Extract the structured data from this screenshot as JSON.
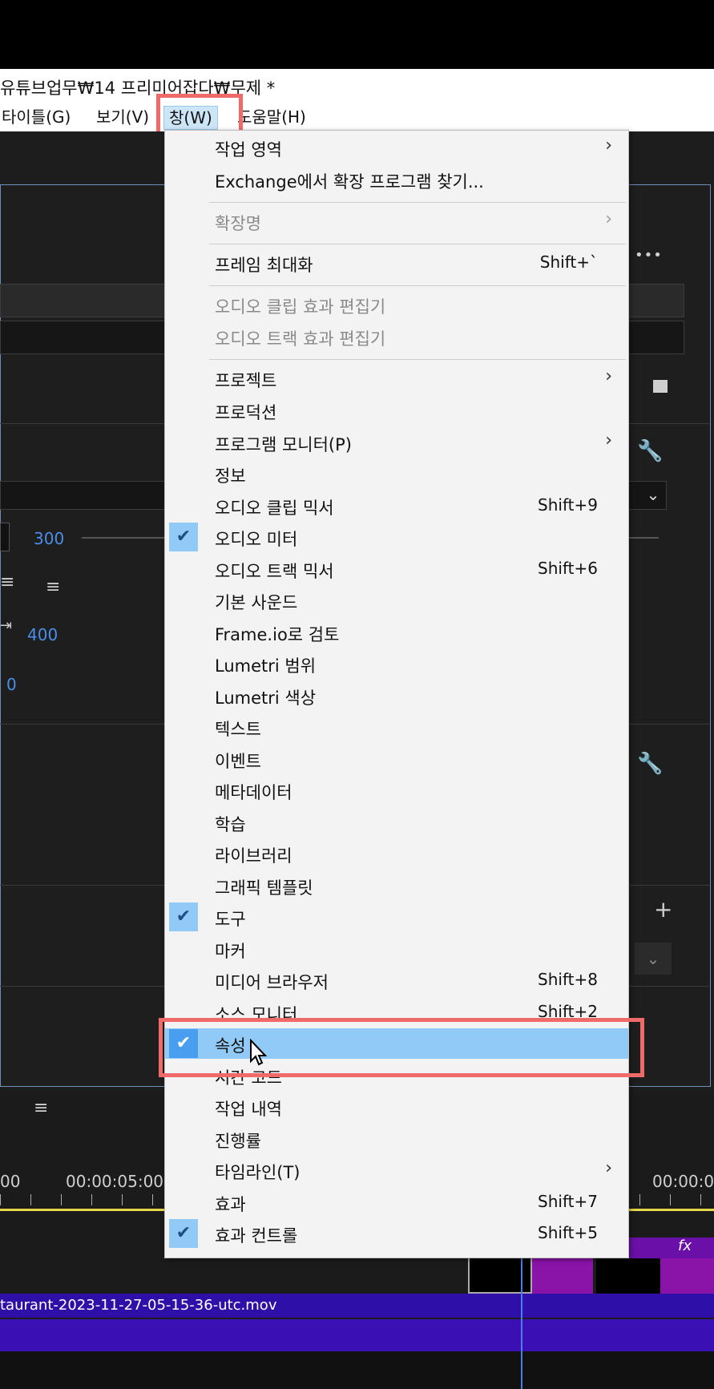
{
  "titlebar": {
    "path": "유튜브업무₩14 프리미어잡다₩무제 *"
  },
  "menubar": {
    "items": [
      {
        "label": "타이틀(G)"
      },
      {
        "label": "보기(V)"
      },
      {
        "label": "창(W)"
      },
      {
        "label": "도움말(H)"
      }
    ]
  },
  "background": {
    "value_300": "300",
    "value_400": "400",
    "value_0": "0",
    "timecode_left": "00",
    "timecode_mid": "00:00:05:00",
    "timecode_right": "00:00:0",
    "clip_name": "taurant-2023-11-27-05-15-36-utc.mov",
    "fx_label": "fx",
    "ellipsis": "•••"
  },
  "menu": {
    "items": [
      {
        "label": "작업 영역",
        "submenu": true
      },
      {
        "label": "Exchange에서 확장 프로그램 찾기..."
      },
      {
        "label": "확장명",
        "submenu": true,
        "disabled": true
      },
      {
        "label": "프레임 최대화",
        "shortcut": "Shift+`"
      },
      {
        "label": "오디오 클립 효과 편집기",
        "disabled": true
      },
      {
        "label": "오디오 트랙 효과 편집기",
        "disabled": true
      },
      {
        "label": "프로젝트",
        "submenu": true
      },
      {
        "label": "프로덕션"
      },
      {
        "label": "프로그램 모니터(P)",
        "submenu": true
      },
      {
        "label": "정보"
      },
      {
        "label": "오디오 클립 믹서",
        "shortcut": "Shift+9"
      },
      {
        "label": "오디오 미터",
        "checked": true
      },
      {
        "label": "오디오 트랙 믹서",
        "shortcut": "Shift+6"
      },
      {
        "label": "기본 사운드"
      },
      {
        "label": "Frame.io로 검토"
      },
      {
        "label": "Lumetri 범위"
      },
      {
        "label": "Lumetri 색상"
      },
      {
        "label": "텍스트"
      },
      {
        "label": "이벤트"
      },
      {
        "label": "메타데이터"
      },
      {
        "label": "학습"
      },
      {
        "label": "라이브러리"
      },
      {
        "label": "그래픽 템플릿"
      },
      {
        "label": "도구",
        "checked": true
      },
      {
        "label": "마커"
      },
      {
        "label": "미디어 브라우저",
        "shortcut": "Shift+8"
      },
      {
        "label": "소스 모니터",
        "shortcut": "Shift+2"
      },
      {
        "label": "속성",
        "checked": true,
        "selected": true
      },
      {
        "label": "시간 코드"
      },
      {
        "label": "작업 내역"
      },
      {
        "label": "진행률"
      },
      {
        "label": "타임라인(T)",
        "submenu": true
      },
      {
        "label": "효과",
        "shortcut": "Shift+7"
      },
      {
        "label": "효과 컨트롤",
        "checked": true,
        "shortcut": "Shift+5"
      }
    ]
  },
  "colors": {
    "highlight_box": "#f06a6a",
    "selected_row": "#91c9f7",
    "check_bg": "#91c9f7",
    "clip": "#3a10b4"
  }
}
